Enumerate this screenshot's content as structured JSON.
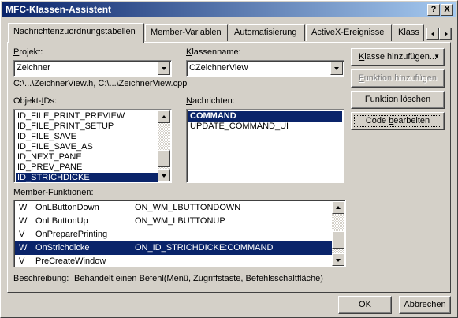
{
  "window": {
    "title": "MFC-Klassen-Assistent"
  },
  "titlebar_buttons": {
    "help": "?",
    "close": "X"
  },
  "tabs": [
    {
      "label": "Nachrichtenzuordnungstabellen",
      "active": true
    },
    {
      "label": "Member-Variablen",
      "active": false
    },
    {
      "label": "Automatisierung",
      "active": false
    },
    {
      "label": "ActiveX-Ereignisse",
      "active": false
    },
    {
      "label": "Klass",
      "active": false
    }
  ],
  "projekt": {
    "label_pre": "",
    "label_acc": "P",
    "label_post": "rojekt:",
    "value": "Zeichner"
  },
  "klassenname": {
    "label_pre": "",
    "label_acc": "K",
    "label_post": "lassenname:",
    "value": "CZeichnerView"
  },
  "file_path": "C:\\...\\ZeichnerView.h, C:\\...\\ZeichnerView.cpp",
  "objekt_ids": {
    "label_pre": "Objekt-",
    "label_acc": "I",
    "label_post": "Ds:",
    "items": [
      "ID_FILE_PRINT_PREVIEW",
      "ID_FILE_PRINT_SETUP",
      "ID_FILE_SAVE",
      "ID_FILE_SAVE_AS",
      "ID_NEXT_PANE",
      "ID_PREV_PANE",
      "ID_STRICHDICKE"
    ],
    "selected_index": 6
  },
  "nachrichten": {
    "label_pre": "",
    "label_acc": "N",
    "label_post": "achrichten:",
    "items": [
      "COMMAND",
      "UPDATE_COMMAND_UI"
    ],
    "selected_index": 0
  },
  "buttons": {
    "klasse_hinzufuegen": {
      "pre": "",
      "acc": "K",
      "post": "lasse hinzufügen...",
      "arrow": "▼"
    },
    "funktion_hinzufuegen": {
      "pre": "",
      "acc": "F",
      "post": "unktion hinzufügen",
      "disabled": true
    },
    "funktion_loeschen": {
      "pre": "Funktion ",
      "acc": "l",
      "post": "öschen"
    },
    "code_bearbeiten": {
      "pre": "Code ",
      "acc": "b",
      "post": "earbeiten"
    },
    "ok": "OK",
    "abbrechen": "Abbrechen"
  },
  "member_funktionen": {
    "label_pre": "",
    "label_acc": "M",
    "label_post": "ember-Funktionen:",
    "rows": [
      {
        "kind": "W",
        "name": "OnLButtonDown",
        "message": "ON_WM_LBUTTONDOWN"
      },
      {
        "kind": "W",
        "name": "OnLButtonUp",
        "message": "ON_WM_LBUTTONUP"
      },
      {
        "kind": "V",
        "name": "OnPreparePrinting",
        "message": ""
      },
      {
        "kind": "W",
        "name": "OnStrichdicke",
        "message": "ON_ID_STRICHDICKE:COMMAND"
      },
      {
        "kind": "V",
        "name": "PreCreateWindow",
        "message": ""
      }
    ],
    "selected_index": 3
  },
  "beschreibung": {
    "label": "Beschreibung:",
    "text": "Behandelt einen Befehl(Menü, Zugriffstaste, Befehlsschaltfläche)"
  },
  "colors": {
    "face": "#d4d0c8",
    "selection": "#0a246a",
    "title_start": "#0a246a",
    "title_end": "#a6caf0"
  }
}
